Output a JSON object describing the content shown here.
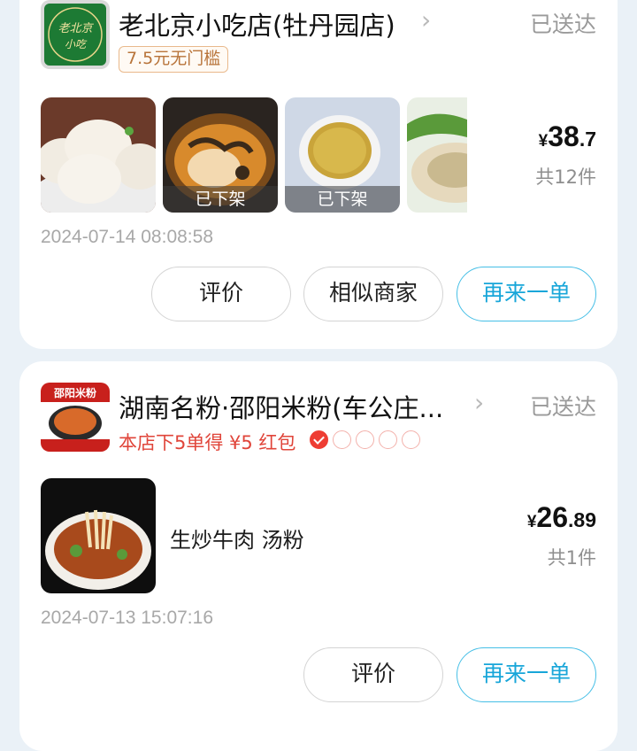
{
  "orders": [
    {
      "shop_name": "老北京小吃店(牡丹园店)",
      "logo_text": "老北京小吃",
      "status": "已送达",
      "coupon": "7.5元无门槛",
      "items": [
        {
          "name": "包子",
          "status": ""
        },
        {
          "name": "炖菜",
          "status": "已下架"
        },
        {
          "name": "小米粥",
          "status": "已下架"
        },
        {
          "name": "包子",
          "status": ""
        }
      ],
      "price": {
        "currency": "¥",
        "int": "38",
        "dec": ".7"
      },
      "count": "共12件",
      "timestamp": "2024-07-14 08:08:58",
      "buttons": {
        "review": "评价",
        "similar": "相似商家",
        "reorder": "再来一单"
      }
    },
    {
      "shop_name": "湖南名粉·邵阳米粉(车公庄...",
      "logo_text": "邵阳米粉",
      "status": "已送达",
      "promo": "本店下5单得 ¥5 红包",
      "promo_progress": {
        "done": 1,
        "total": 5
      },
      "item_name": "生炒牛肉 汤粉",
      "price": {
        "currency": "¥",
        "int": "26",
        "dec": ".89"
      },
      "count": "共1件",
      "timestamp": "2024-07-13 15:07:16",
      "buttons": {
        "review": "评价",
        "reorder": "再来一单"
      }
    }
  ],
  "colors": {
    "accent": "#18a6d9",
    "promo_red": "#e0453a",
    "coupon": "#b8743a"
  }
}
